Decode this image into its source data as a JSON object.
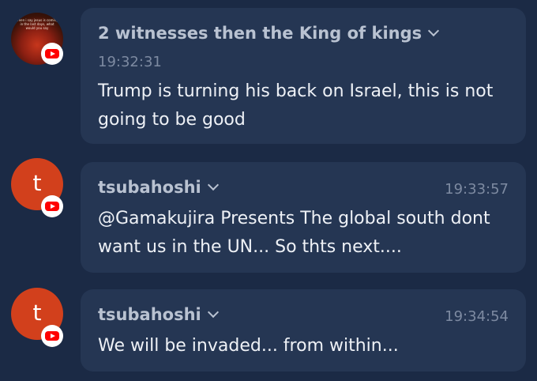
{
  "messages": [
    {
      "author": "2 witnesses then the King of kings",
      "time": "19:32:31",
      "text": "Trump is turning his back on Israel, this is not going to be good",
      "avatar": {
        "type": "image",
        "thumbnail_text": "when i say jesus is coming in the last days, what would you say"
      },
      "platform_icon": "youtube-icon"
    },
    {
      "author": "tsubahoshi",
      "time": "19:33:57",
      "text": "@Gamakujira Presents The global south dont want us in the UN... So thts next....",
      "avatar": {
        "type": "letter",
        "letter": "t",
        "color": "#d2401c"
      },
      "platform_icon": "youtube-icon"
    },
    {
      "author": "tsubahoshi",
      "time": "19:34:54",
      "text": "We will be invaded... from within...",
      "avatar": {
        "type": "letter",
        "letter": "t",
        "color": "#d2401c"
      },
      "platform_icon": "youtube-icon"
    }
  ],
  "colors": {
    "background": "#1b2a45",
    "bubble": "#253653",
    "author": "#b9c2d1",
    "timestamp": "#7d8aa1",
    "message_text": "#eef1f6",
    "youtube_red": "#ff0000"
  }
}
